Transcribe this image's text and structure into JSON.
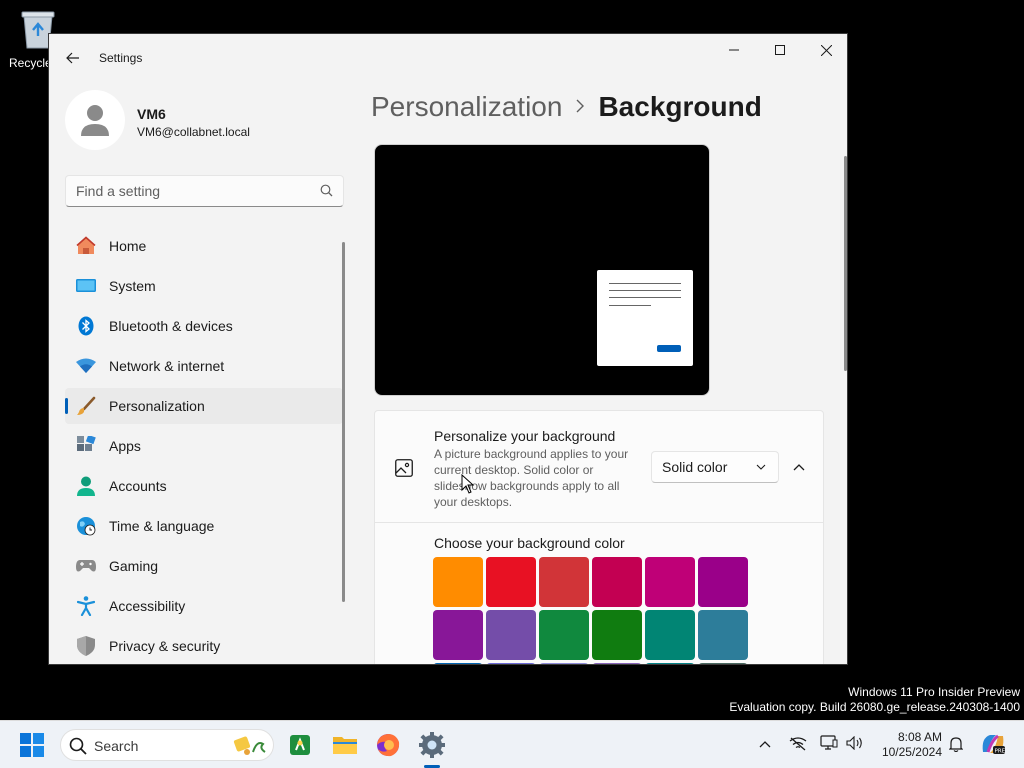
{
  "desktop": {
    "recycle_label": "Recycle",
    "watermark_line1": "Windows 11 Pro Insider Preview",
    "watermark_line2": "Evaluation copy. Build 26080.ge_release.240308-1400"
  },
  "window": {
    "app_title": "Settings"
  },
  "profile": {
    "name": "VM6",
    "email": "VM6@collabnet.local"
  },
  "search": {
    "placeholder": "Find a setting"
  },
  "nav": {
    "items": [
      {
        "label": "Home",
        "icon": "home-icon"
      },
      {
        "label": "System",
        "icon": "system-icon"
      },
      {
        "label": "Bluetooth & devices",
        "icon": "bluetooth-icon"
      },
      {
        "label": "Network & internet",
        "icon": "wifi-icon"
      },
      {
        "label": "Personalization",
        "icon": "brush-icon",
        "selected": true
      },
      {
        "label": "Apps",
        "icon": "apps-icon"
      },
      {
        "label": "Accounts",
        "icon": "person-icon"
      },
      {
        "label": "Time & language",
        "icon": "globe-clock-icon"
      },
      {
        "label": "Gaming",
        "icon": "controller-icon"
      },
      {
        "label": "Accessibility",
        "icon": "accessibility-icon"
      },
      {
        "label": "Privacy & security",
        "icon": "shield-icon"
      }
    ]
  },
  "main": {
    "breadcrumb_parent": "Personalization",
    "breadcrumb_current": "Background",
    "background_card": {
      "title": "Personalize your background",
      "description": "A picture background applies to your current desktop. Solid color or slideshow backgrounds apply to all your desktops.",
      "dropdown_value": "Solid color"
    },
    "color_section": {
      "label": "Choose your background color",
      "colors": [
        "#FF8C00",
        "#E81123",
        "#D13438",
        "#C30052",
        "#BF0077",
        "#9A0089",
        "#881798",
        "#744DA9",
        "#10893E",
        "#107C10",
        "#018574",
        "#2D7D9A"
      ],
      "partial_colors": [
        "#0063B1",
        "#6B69D6",
        "#8E8CD8",
        "#8764B8",
        "#038387",
        "#486860"
      ]
    }
  },
  "taskbar": {
    "search_label": "Search",
    "time": "8:08 AM",
    "date": "10/25/2024",
    "accent": "#005fb8"
  }
}
